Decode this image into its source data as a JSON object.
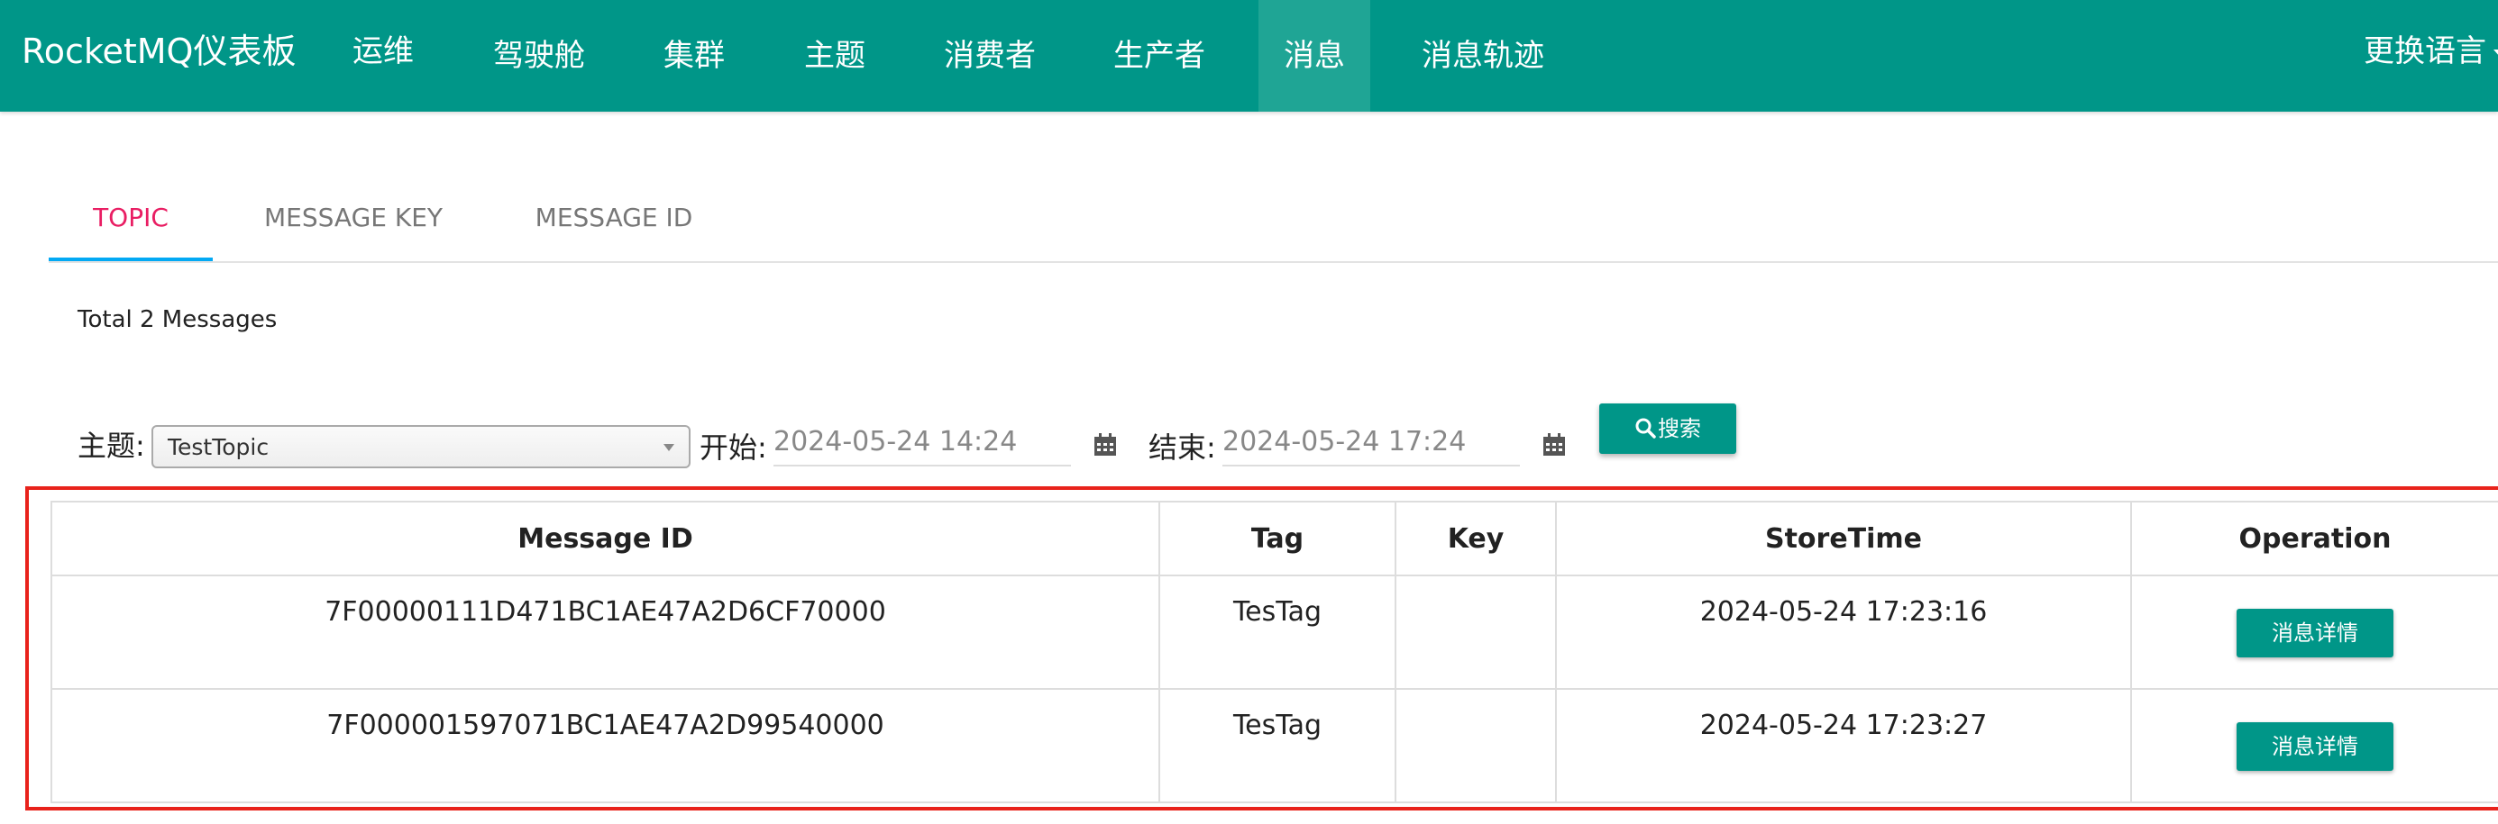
{
  "navbar": {
    "brand": "RocketMQ仪表板",
    "items": [
      {
        "label": "运维"
      },
      {
        "label": "驾驶舱"
      },
      {
        "label": "集群"
      },
      {
        "label": "主题"
      },
      {
        "label": "消费者"
      },
      {
        "label": "生产者"
      },
      {
        "label": "消息"
      },
      {
        "label": "消息轨迹"
      }
    ],
    "active_index": 6,
    "language_label": "更换语言"
  },
  "tabs": [
    {
      "label": "TOPIC"
    },
    {
      "label": "MESSAGE KEY"
    },
    {
      "label": "MESSAGE ID"
    }
  ],
  "active_tab": 0,
  "summary": "Total 2 Messages",
  "search": {
    "topic_label": "主题:",
    "topic_value": "TestTopic",
    "start_label": "开始:",
    "start_value": "2024-05-24 14:24",
    "end_label": "结束:",
    "end_value": "2024-05-24 17:24",
    "search_button": "搜索"
  },
  "table": {
    "columns": [
      "Message ID",
      "Tag",
      "Key",
      "StoreTime",
      "Operation"
    ],
    "rows": [
      {
        "message_id": "7F00000111D471BC1AE47A2D6CF70000",
        "tag": "TesTag",
        "key": "",
        "store_time": "2024-05-24 17:23:16",
        "operation": "消息详情"
      },
      {
        "message_id": "7F000001597071BC1AE47A2D99540000",
        "tag": "TesTag",
        "key": "",
        "store_time": "2024-05-24 17:23:27",
        "operation": "消息详情"
      }
    ]
  },
  "colors": {
    "primary": "#009688",
    "active_tab_text": "#e91e63",
    "tab_underline": "#03a9f4",
    "highlight_box": "#e8221b"
  }
}
